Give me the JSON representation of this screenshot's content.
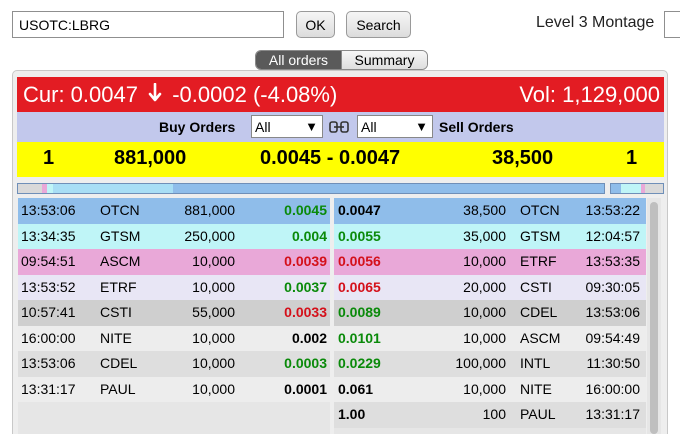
{
  "toolbar": {
    "symbol_value": "USOTC:LBRG",
    "ok_label": "OK",
    "search_label": "Search",
    "title": "Level 3 Montage"
  },
  "tabs": [
    {
      "label": "All orders",
      "active": true
    },
    {
      "label": "Summary",
      "active": false
    }
  ],
  "quote": {
    "cur": "Cur: 0.0047",
    "change": "-0.0002 (-4.08%)",
    "direction_icon": "arrow-down-icon",
    "vol": "Vol: 1,129,000",
    "bar_color": "#e31c23"
  },
  "filters": {
    "buy_label": "Buy Orders",
    "sell_label": "Sell Orders",
    "buy_value": "All",
    "sell_value": "All",
    "link_icon": "chain-link-icon"
  },
  "inside": {
    "bid_count": "1",
    "bid_size": "881,000",
    "spread": "0.0045 - 0.0047",
    "ask_size": "38,500",
    "ask_count": "1"
  },
  "buy_orders": [
    {
      "time": "13:53:06",
      "mm": "OTCN",
      "size": "881,000",
      "price": "0.0045",
      "bg": "#8fbdea",
      "price_color": "#0a8a0a"
    },
    {
      "time": "13:34:35",
      "mm": "GTSM",
      "size": "250,000",
      "price": "0.004",
      "bg": "#bff5f7",
      "price_color": "#0a8a0a"
    },
    {
      "time": "09:54:51",
      "mm": "ASCM",
      "size": "10,000",
      "price": "0.0039",
      "bg": "#e9a8d8",
      "price_color": "#d4101a"
    },
    {
      "time": "13:53:52",
      "mm": "ETRF",
      "size": "10,000",
      "price": "0.0037",
      "bg": "#e8e6f5",
      "price_color": "#0a8a0a"
    },
    {
      "time": "10:57:41",
      "mm": "CSTI",
      "size": "55,000",
      "price": "0.0033",
      "bg": "#cfcfcf",
      "price_color": "#d4101a"
    },
    {
      "time": "16:00:00",
      "mm": "NITE",
      "size": "10,000",
      "price": "0.002",
      "bg": "#ededed",
      "price_color": "#000000"
    },
    {
      "time": "13:53:06",
      "mm": "CDEL",
      "size": "10,000",
      "price": "0.0003",
      "bg": "#dedede",
      "price_color": "#0a8a0a"
    },
    {
      "time": "13:31:17",
      "mm": "PAUL",
      "size": "10,000",
      "price": "0.0001",
      "bg": "#ededed",
      "price_color": "#000000"
    }
  ],
  "sell_orders": [
    {
      "price": "0.0047",
      "size": "38,500",
      "mm": "OTCN",
      "time": "13:53:22",
      "bg": "#8fbdea",
      "price_color": "#000000"
    },
    {
      "price": "0.0055",
      "size": "35,000",
      "mm": "GTSM",
      "time": "12:04:57",
      "bg": "#bff5f7",
      "price_color": "#0a8a0a"
    },
    {
      "price": "0.0056",
      "size": "10,000",
      "mm": "ETRF",
      "time": "13:53:35",
      "bg": "#e9a8d8",
      "price_color": "#d4101a"
    },
    {
      "price": "0.0065",
      "size": "20,000",
      "mm": "CSTI",
      "time": "09:30:05",
      "bg": "#e8e6f5",
      "price_color": "#d4101a"
    },
    {
      "price": "0.0089",
      "size": "10,000",
      "mm": "CDEL",
      "time": "13:53:06",
      "bg": "#cfcfcf",
      "price_color": "#0a8a0a"
    },
    {
      "price": "0.0101",
      "size": "10,000",
      "mm": "ASCM",
      "time": "09:54:49",
      "bg": "#ededed",
      "price_color": "#0a8a0a"
    },
    {
      "price": "0.0229",
      "size": "100,000",
      "mm": "INTL",
      "time": "11:30:50",
      "bg": "#dedede",
      "price_color": "#0a8a0a"
    },
    {
      "price": "0.061",
      "size": "10,000",
      "mm": "NITE",
      "time": "16:00:00",
      "bg": "#ededed",
      "price_color": "#000000"
    },
    {
      "price": "1.00",
      "size": "100",
      "mm": "PAUL",
      "time": "13:31:17",
      "bg": "#dedede",
      "price_color": "#000000"
    }
  ]
}
